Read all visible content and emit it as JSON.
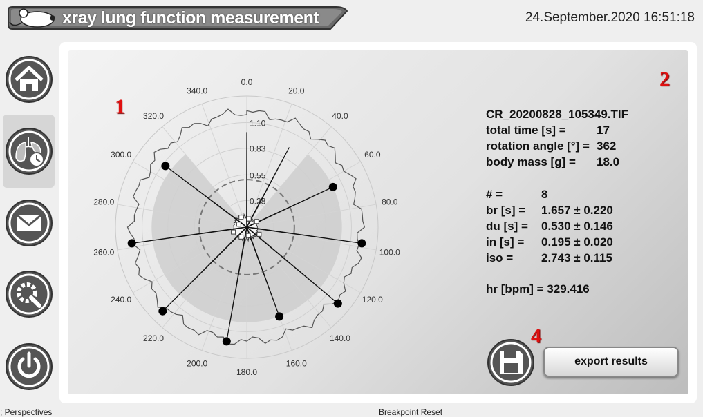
{
  "app": {
    "title": "xray lung function measurement",
    "datetime": "24.September.2020 16:51:18"
  },
  "sidebar": {
    "items": [
      {
        "icon": "home-icon"
      },
      {
        "icon": "lung-measurement-icon",
        "selected": true
      },
      {
        "icon": "mail-icon"
      },
      {
        "icon": "settings-icon"
      },
      {
        "icon": "power-icon"
      }
    ]
  },
  "badges": {
    "one": "1",
    "two": "2",
    "four": "4"
  },
  "info": {
    "filename": "CR_20200828_105349.TIF",
    "total_time_label": "total time [s] =",
    "total_time_value": "17",
    "rotation_label": "rotation angle [°] =",
    "rotation_value": "362",
    "body_mass_label": "body mass [g] =",
    "body_mass_value": "18.0",
    "count_label": "# =",
    "count_value": "8",
    "br_label": "br [s] =",
    "br_value": "1.657 ± 0.220",
    "du_label": "du [s] =",
    "du_value": "0.530 ± 0.146",
    "in_label": "in [s] =",
    "in_value": "0.195 ± 0.020",
    "iso_label": "iso =",
    "iso_value": "2.743 ± 0.115",
    "hr": "hr [bpm] = 329.416"
  },
  "actions": {
    "export_label": "export results",
    "save_icon": "floppy-disk-icon"
  },
  "bottom": {
    "left": "; Perspectives",
    "right": "Breakpoint Reset"
  },
  "chart_data": {
    "type": "polar",
    "angle_ticks": [
      "0.0",
      "20.0",
      "40.0",
      "60.0",
      "80.0",
      "100.0",
      "120.0",
      "140.0",
      "160.0",
      "180.0",
      "200.0",
      "220.0",
      "240.0",
      "260.0",
      "280.0",
      "300.0",
      "320.0",
      "340.0"
    ],
    "radial_ticks": [
      "0.28",
      "0.55",
      "0.83",
      "1.10"
    ],
    "radial_values": [
      0.28,
      0.55,
      0.83,
      1.1
    ],
    "rmax": 1.38,
    "spikes": [
      {
        "angle": 0,
        "r": 1.0
      },
      {
        "angle": 28,
        "r": 0.95
      },
      {
        "angle": 65,
        "r": 1.0,
        "marker": true
      },
      {
        "angle": 98,
        "r": 1.22,
        "marker": true
      },
      {
        "angle": 130,
        "r": 1.25,
        "marker": true
      },
      {
        "angle": 160,
        "r": 1.0,
        "marker": true
      },
      {
        "angle": 190,
        "r": 1.22,
        "marker": true
      },
      {
        "angle": 225,
        "r": 1.25,
        "marker": true
      },
      {
        "angle": 262,
        "r": 1.22,
        "marker": true
      },
      {
        "angle": 307,
        "r": 1.07,
        "marker": true
      }
    ],
    "sectors": [
      {
        "from": 40,
        "to": 320,
        "r": 1.0
      }
    ],
    "inner_dashed_r": 0.5,
    "envelope_r": 1.2
  }
}
